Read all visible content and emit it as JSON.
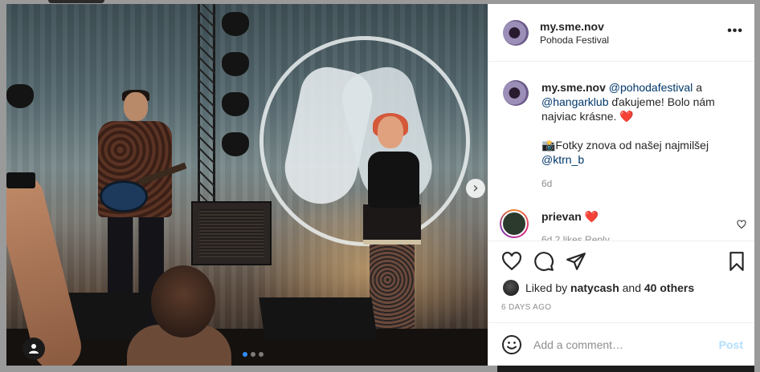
{
  "post": {
    "username": "my.sme.nov",
    "location": "Pohoda Festival"
  },
  "caption": {
    "username": "my.sme.nov",
    "mention1": "@pohodafestival",
    "and": "a",
    "mention2": "@hangarklub",
    "text1": "ďakujeme! Bolo nám",
    "text2": "najviac krásne.",
    "heart": "❤️",
    "text3": "📸Fotky znova od našej najmilšej",
    "mention3": "@ktrn_b",
    "time": "6d"
  },
  "comment": {
    "username": "prievan",
    "text": "❤️",
    "meta": "6d  2 likes  Reply"
  },
  "likes": {
    "prefix": "Liked by",
    "user": "natycash",
    "and": "and",
    "others": "40 others"
  },
  "timestamp": "6 DAYS AGO",
  "add_comment": {
    "placeholder": "Add a comment…",
    "post_label": "Post"
  },
  "carousel": {
    "next_glyph": "›",
    "slide_count": 3,
    "active_slide": 1
  },
  "more_glyph": "•••",
  "colors": {
    "link": "#00376b",
    "post_disabled": "#b2dffc",
    "carousel_active": "#2f8fff"
  }
}
